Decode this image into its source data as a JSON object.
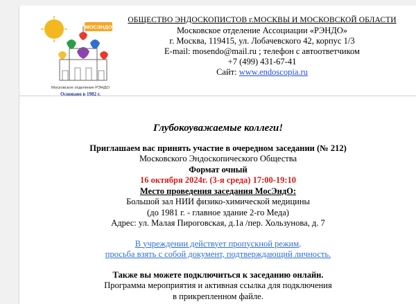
{
  "header": {
    "org_name": "ОБЩЕСТВО ЭНДОСКОПИСТОВ г.МОСКВЫ И МОСКОВСКОЙ ОБЛАСТИ",
    "branch": "Московское отделение Ассоциации «РЭНДО»",
    "address": "г. Москва, 119415, ул. Лобачевского 42, корпус 1/3",
    "email_line": "E-mail: mosendo@mail.ru ; телефон с автоответчиком",
    "phone": "+7 (499) 431-67-41",
    "site_label": "Сайт: ",
    "site_link": "www.endoscopia.ru"
  },
  "logo": {
    "badge": "МОСЭНДО",
    "caption": "Московское отделение РЭНДО",
    "founded": "Основано в 1982 г."
  },
  "body": {
    "greeting": "Глубокоуважаемые коллеги!",
    "invite": "Приглашаем вас принять участие в очередном заседании (№ 212)",
    "society": "Московского Эндоскопического Общества",
    "format": "Формат очный",
    "datetime": "16 октября 2024г. (3-я среда) 17:00-19:10",
    "venue_heading": "Место проведения заседания МосЭндО:",
    "venue_line1": "Большой зал НИИ физико-химической медицины",
    "venue_line2": "(до 1981 г. - главное здание 2-го Меда)",
    "venue_address": "Адрес: ул. Малая Пироговская, д.1а /пер. Хользунова, д. 7",
    "notice_line1": "В учреждении действует пропускной режим,",
    "notice_line2": "просьба взять с собой документ, подтверждающий личность.",
    "online": "Также вы можете подключиться к заседанию онлайн.",
    "program_line1": "Программа мероприятия и активная ссылка для подключения",
    "program_line2": "в прикрепленном файле."
  },
  "colors": {
    "accent_red": "#d61a1a",
    "link_blue": "#1f4ed8",
    "notice_blue": "#2e6fd6"
  }
}
